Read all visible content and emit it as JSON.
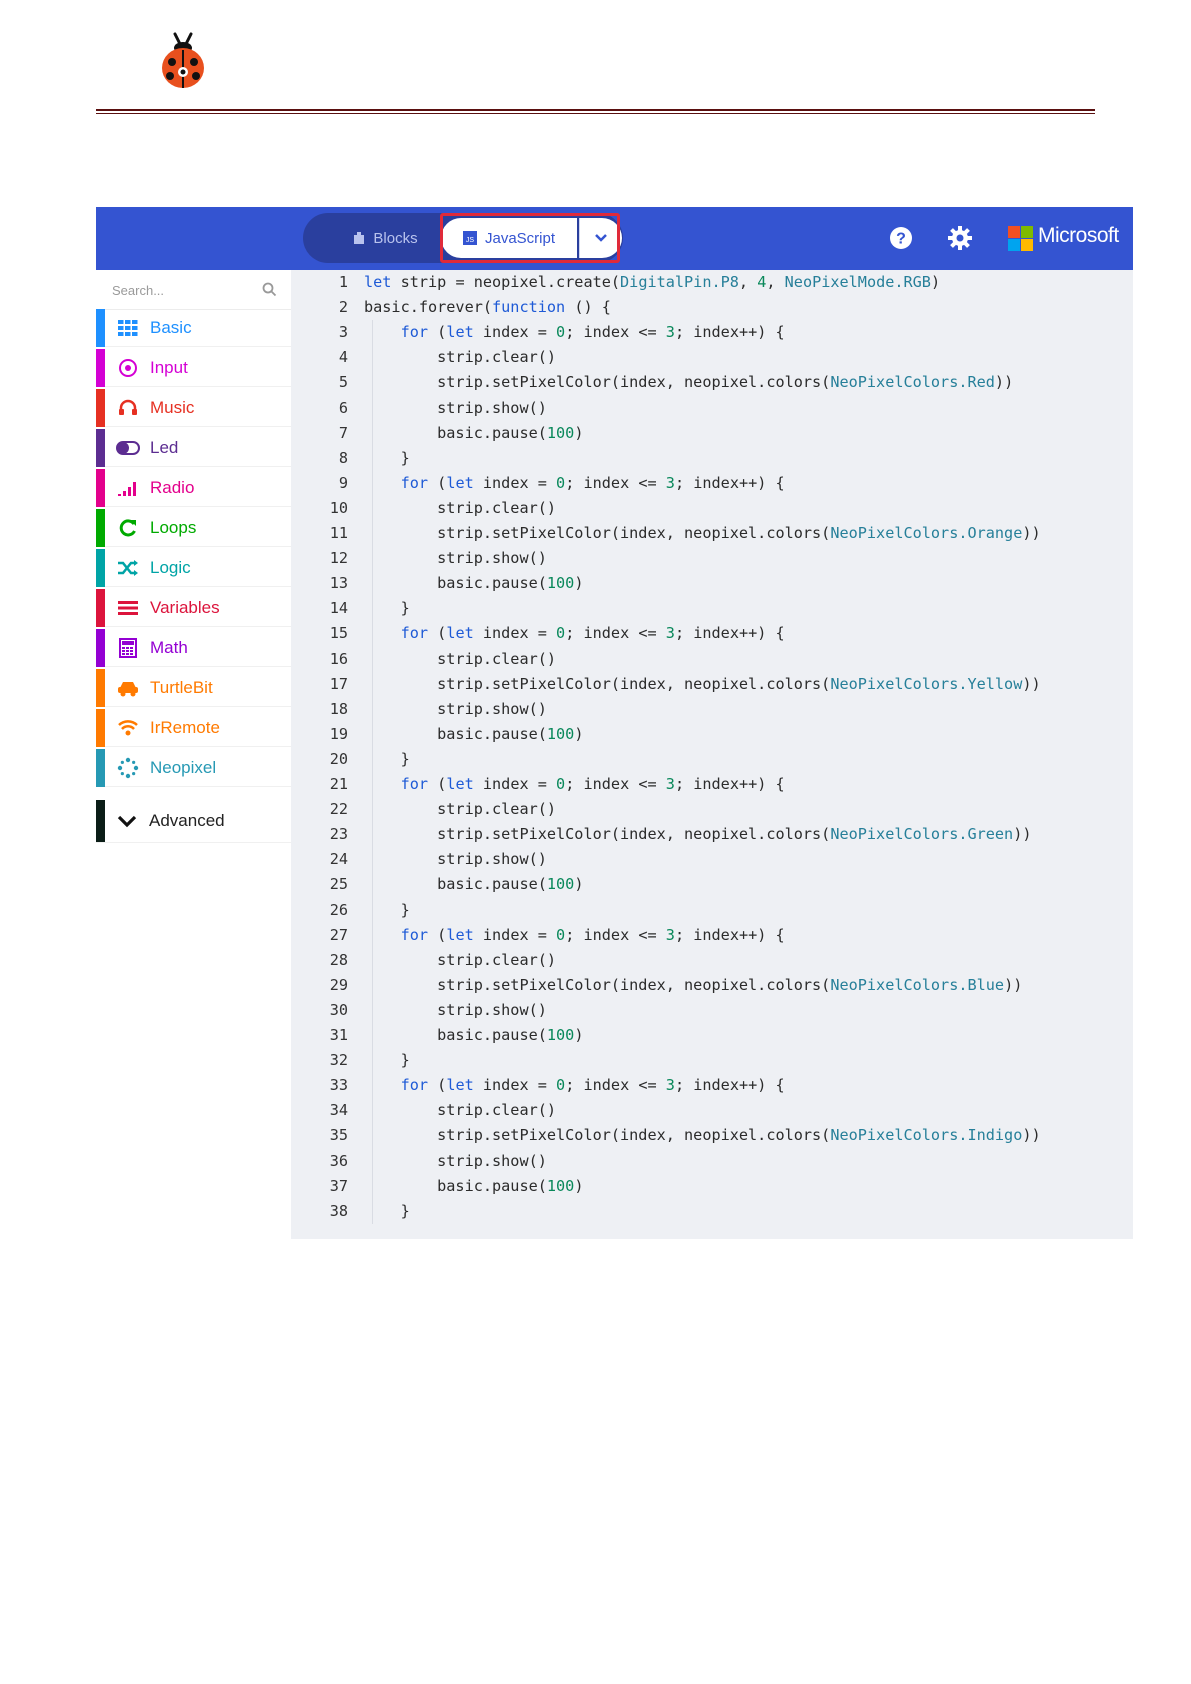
{
  "editor": {
    "tabs": {
      "blocks": "Blocks",
      "javascript": "JavaScript"
    },
    "brand": "Microsoft",
    "brand_colors": [
      "#f25022",
      "#7fba00",
      "#00a4ef",
      "#ffb900"
    ],
    "topbar_color": "#3454d1",
    "highlight_color": "#e02a3a"
  },
  "sidebar": {
    "search_placeholder": "Search...",
    "categories": [
      {
        "label": "Basic",
        "color": "#1e90ff",
        "icon": "grid-icon"
      },
      {
        "label": "Input",
        "color": "#d400d4",
        "icon": "target-icon"
      },
      {
        "label": "Music",
        "color": "#e63022",
        "icon": "headphones-icon"
      },
      {
        "label": "Led",
        "color": "#5c2d91",
        "icon": "toggle-icon"
      },
      {
        "label": "Radio",
        "color": "#e3008c",
        "icon": "signal-icon"
      },
      {
        "label": "Loops",
        "color": "#00aa00",
        "icon": "refresh-icon"
      },
      {
        "label": "Logic",
        "color": "#00a4a6",
        "icon": "shuffle-icon"
      },
      {
        "label": "Variables",
        "color": "#dc143c",
        "icon": "list-icon"
      },
      {
        "label": "Math",
        "color": "#9400d3",
        "icon": "calculator-icon"
      },
      {
        "label": "TurtleBit",
        "color": "#ff7a00",
        "icon": "car-icon"
      },
      {
        "label": "IrRemote",
        "color": "#ff7a00",
        "icon": "wifi-icon"
      },
      {
        "label": "Neopixel",
        "color": "#2699b4",
        "icon": "dots-circle-icon"
      }
    ],
    "advanced": "Advanced"
  },
  "code_lines": [
    "let strip = neopixel.create(DigitalPin.P8, 4, NeoPixelMode.RGB)",
    "basic.forever(function () {",
    "    for (let index = 0; index <= 3; index++) {",
    "        strip.clear()",
    "        strip.setPixelColor(index, neopixel.colors(NeoPixelColors.Red))",
    "        strip.show()",
    "        basic.pause(100)",
    "    }",
    "    for (let index = 0; index <= 3; index++) {",
    "        strip.clear()",
    "        strip.setPixelColor(index, neopixel.colors(NeoPixelColors.Orange))",
    "        strip.show()",
    "        basic.pause(100)",
    "    }",
    "    for (let index = 0; index <= 3; index++) {",
    "        strip.clear()",
    "        strip.setPixelColor(index, neopixel.colors(NeoPixelColors.Yellow))",
    "        strip.show()",
    "        basic.pause(100)",
    "    }",
    "    for (let index = 0; index <= 3; index++) {",
    "        strip.clear()",
    "        strip.setPixelColor(index, neopixel.colors(NeoPixelColors.Green))",
    "        strip.show()",
    "        basic.pause(100)",
    "    }",
    "    for (let index = 0; index <= 3; index++) {",
    "        strip.clear()",
    "        strip.setPixelColor(index, neopixel.colors(NeoPixelColors.Blue))",
    "        strip.show()",
    "        basic.pause(100)",
    "    }",
    "    for (let index = 0; index <= 3; index++) {",
    "        strip.clear()",
    "        strip.setPixelColor(index, neopixel.colors(NeoPixelColors.Indigo))",
    "        strip.show()",
    "        basic.pause(100)",
    "    }"
  ]
}
